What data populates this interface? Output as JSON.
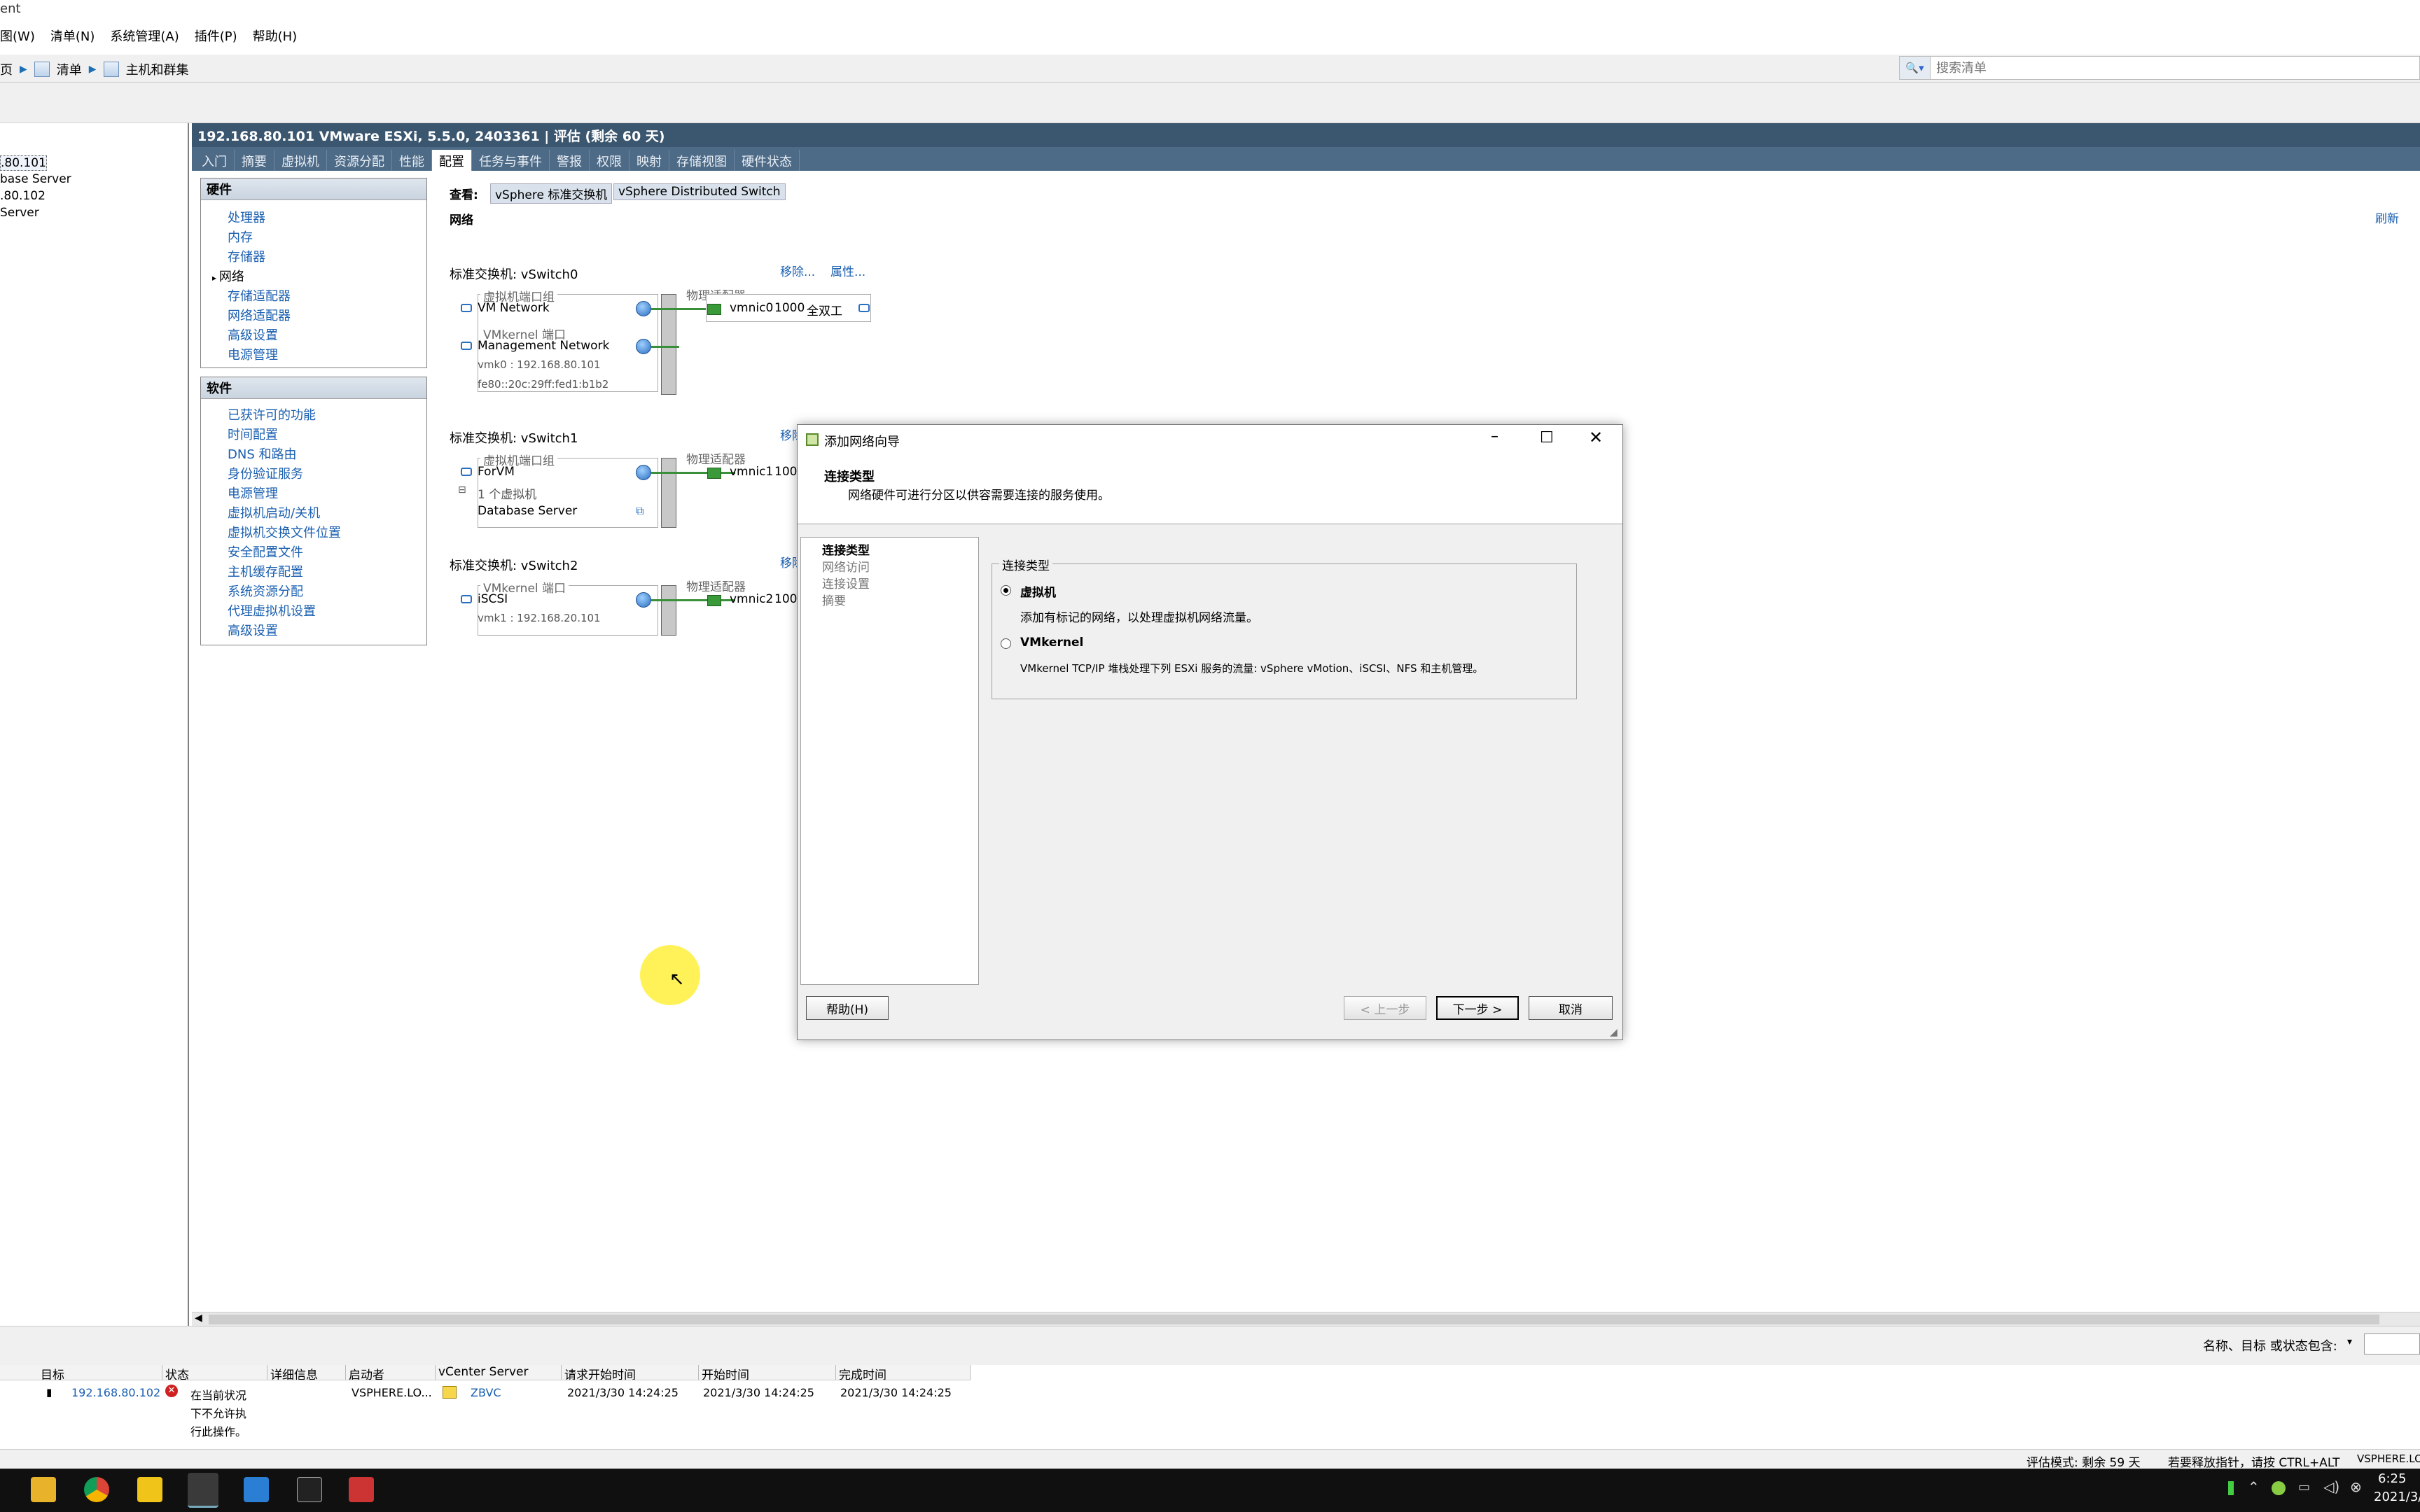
{
  "app": {
    "title_fragment": "ent",
    "menus": [
      "图(W)",
      "清单(N)",
      "系统管理(A)",
      "插件(P)",
      "帮助(H)"
    ]
  },
  "address": {
    "home_fragment": "页",
    "crumbs": [
      "清单",
      "主机和群集"
    ],
    "search_placeholder": "搜索清单"
  },
  "tree": {
    "items": [
      ".80.101",
      "base Server",
      ".80.102",
      "Server"
    ]
  },
  "host": {
    "header": "192.168.80.101 VMware ESXi, 5.5.0, 2403361 | 评估 (剩余 60 天)",
    "tabs": [
      "入门",
      "摘要",
      "虚拟机",
      "资源分配",
      "性能",
      "配置",
      "任务与事件",
      "警报",
      "权限",
      "映射",
      "存储视图",
      "硬件状态"
    ]
  },
  "config": {
    "hardware_title": "硬件",
    "hardware_items": [
      "处理器",
      "内存",
      "存储器",
      "网络",
      "存储适配器",
      "网络适配器",
      "高级设置",
      "电源管理"
    ],
    "software_title": "软件",
    "software_items": [
      "已获许可的功能",
      "时间配置",
      "DNS 和路由",
      "身份验证服务",
      "电源管理",
      "虚拟机启动/关机",
      "虚拟机交换文件位置",
      "安全配置文件",
      "主机缓存配置",
      "系统资源分配",
      "代理虚拟机设置",
      "高级设置"
    ],
    "view_label": "查看:",
    "view_options": [
      "vSphere 标准交换机",
      "vSphere Distributed Switch"
    ],
    "section_title": "网络",
    "refresh": "刷新",
    "remove_link": "移除...",
    "props_link": "属性...",
    "switches": [
      {
        "title": "标准交换机: vSwitch0",
        "group1_caption": "虚拟机端口组",
        "group1": "VM Network",
        "group2_caption": "VMkernel 端口",
        "group2": "Management Network",
        "detail1": "vmk0 : 192.168.80.101",
        "detail2": "fe80::20c:29ff:fed1:b1b2",
        "adapter_caption": "物理适配器",
        "vmnic": "vmnic0",
        "speed": "1000",
        "duplex": "全双工"
      },
      {
        "title": "标准交换机: vSwitch1",
        "remove_frag": "移除",
        "group1_caption": "虚拟机端口组",
        "group1": "ForVM",
        "detail1": "1 个虚拟机",
        "detail2": "Database Server",
        "adapter_caption": "物理适配器",
        "vmnic": "vmnic1",
        "speed": "1000"
      },
      {
        "title": "标准交换机: vSwitch2",
        "remove_frag": "移除",
        "group1_caption": "VMkernel 端口",
        "group1": "iSCSI",
        "detail1": "vmk1 : 192.168.20.101",
        "adapter_caption": "物理适配器",
        "vmnic": "vmnic2",
        "speed": "1000"
      }
    ]
  },
  "dialog": {
    "title": "添加网络向导",
    "heading": "连接类型",
    "subheading": "网络硬件可进行分区以供容需要连接的服务使用。",
    "steps": [
      "连接类型",
      "网络访问",
      "连接设置",
      "摘要"
    ],
    "group_label": "连接类型",
    "option1_label": "虚拟机",
    "option1_desc": "添加有标记的网络，以处理虚拟机网络流量。",
    "option2_label": "VMkernel",
    "option2_desc": "VMkernel TCP/IP 堆栈处理下列 ESXi 服务的流量: vSphere vMotion、iSCSI、NFS 和主机管理。",
    "help": "帮助(H)",
    "back": "< 上一步",
    "next": "下一步 >",
    "cancel": "取消"
  },
  "filter": {
    "label": "名称、目标 或状态包含: "
  },
  "tasks": {
    "columns": [
      "目标",
      "状态",
      "详细信息",
      "启动者",
      "vCenter Server",
      "请求开始时间",
      "开始时间",
      "完成时间"
    ],
    "row": {
      "target": "192.168.80.102",
      "status_line1": "在当前状况",
      "status_line2": "下不允许执",
      "status_line3": "行此操作。",
      "initiator": "VSPHERE.LO...",
      "vcenter": "ZBVC",
      "requested": "2021/3/30 14:24:25",
      "started": "2021/3/30 14:24:25",
      "completed": "2021/3/30 14:24:25"
    }
  },
  "statusbar": {
    "eval": "评估模式: 剩余 59 天",
    "hint": "若要释放指针，请按 CTRL+ALT",
    "user": "VSPHERE.LO"
  },
  "clock": {
    "time": "6:25",
    "date": "2021/3/"
  }
}
